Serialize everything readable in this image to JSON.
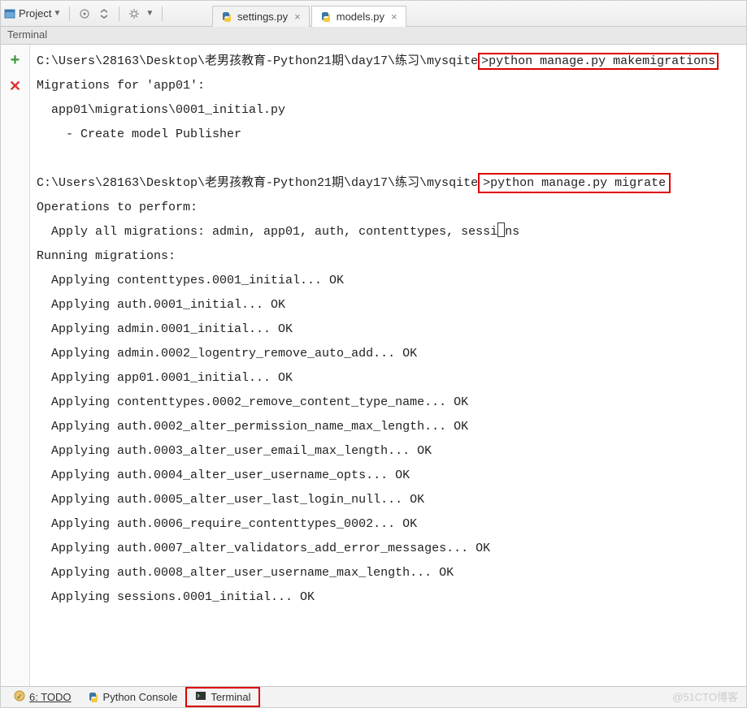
{
  "toolbar": {
    "project_label": "Project"
  },
  "tabs": {
    "settings": "settings.py",
    "models": "models.py"
  },
  "panel": {
    "title": "Terminal"
  },
  "terminal": {
    "line1_pre": "C:\\Users\\28163\\Desktop\\老男孩教育-Python21期\\day17\\练习\\mysqite",
    "line1_cmd": ">python manage.py makemigrations",
    "line2": "Migrations for 'app01':",
    "line3": "  app01\\migrations\\0001_initial.py",
    "line4": "    - Create model Publisher",
    "line5": " ",
    "line6_pre": "C:\\Users\\28163\\Desktop\\老男孩教育-Python21期\\day17\\练习\\mysqite",
    "line6_cmd": ">python manage.py migrate",
    "line7": "Operations to perform:",
    "line8a": "  Apply all migrations: admin, app01, auth, contenttypes, sessi",
    "line8b": "o",
    "line8c": "ns",
    "line9": "Running migrations:",
    "line10": "  Applying contenttypes.0001_initial... OK",
    "line11": "  Applying auth.0001_initial... OK",
    "line12": "  Applying admin.0001_initial... OK",
    "line13": "  Applying admin.0002_logentry_remove_auto_add... OK",
    "line14": "  Applying app01.0001_initial... OK",
    "line15": "  Applying contenttypes.0002_remove_content_type_name... OK",
    "line16": "  Applying auth.0002_alter_permission_name_max_length... OK",
    "line17": "  Applying auth.0003_alter_user_email_max_length... OK",
    "line18": "  Applying auth.0004_alter_user_username_opts... OK",
    "line19": "  Applying auth.0005_alter_user_last_login_null... OK",
    "line20": "  Applying auth.0006_require_contenttypes_0002... OK",
    "line21": "  Applying auth.0007_alter_validators_add_error_messages... OK",
    "line22": "  Applying auth.0008_alter_user_username_max_length... OK",
    "line23": "  Applying sessions.0001_initial... OK"
  },
  "bottom": {
    "todo": "6: TODO",
    "console": "Python Console",
    "terminal": "Terminal"
  },
  "watermark": "@51CTO博客"
}
